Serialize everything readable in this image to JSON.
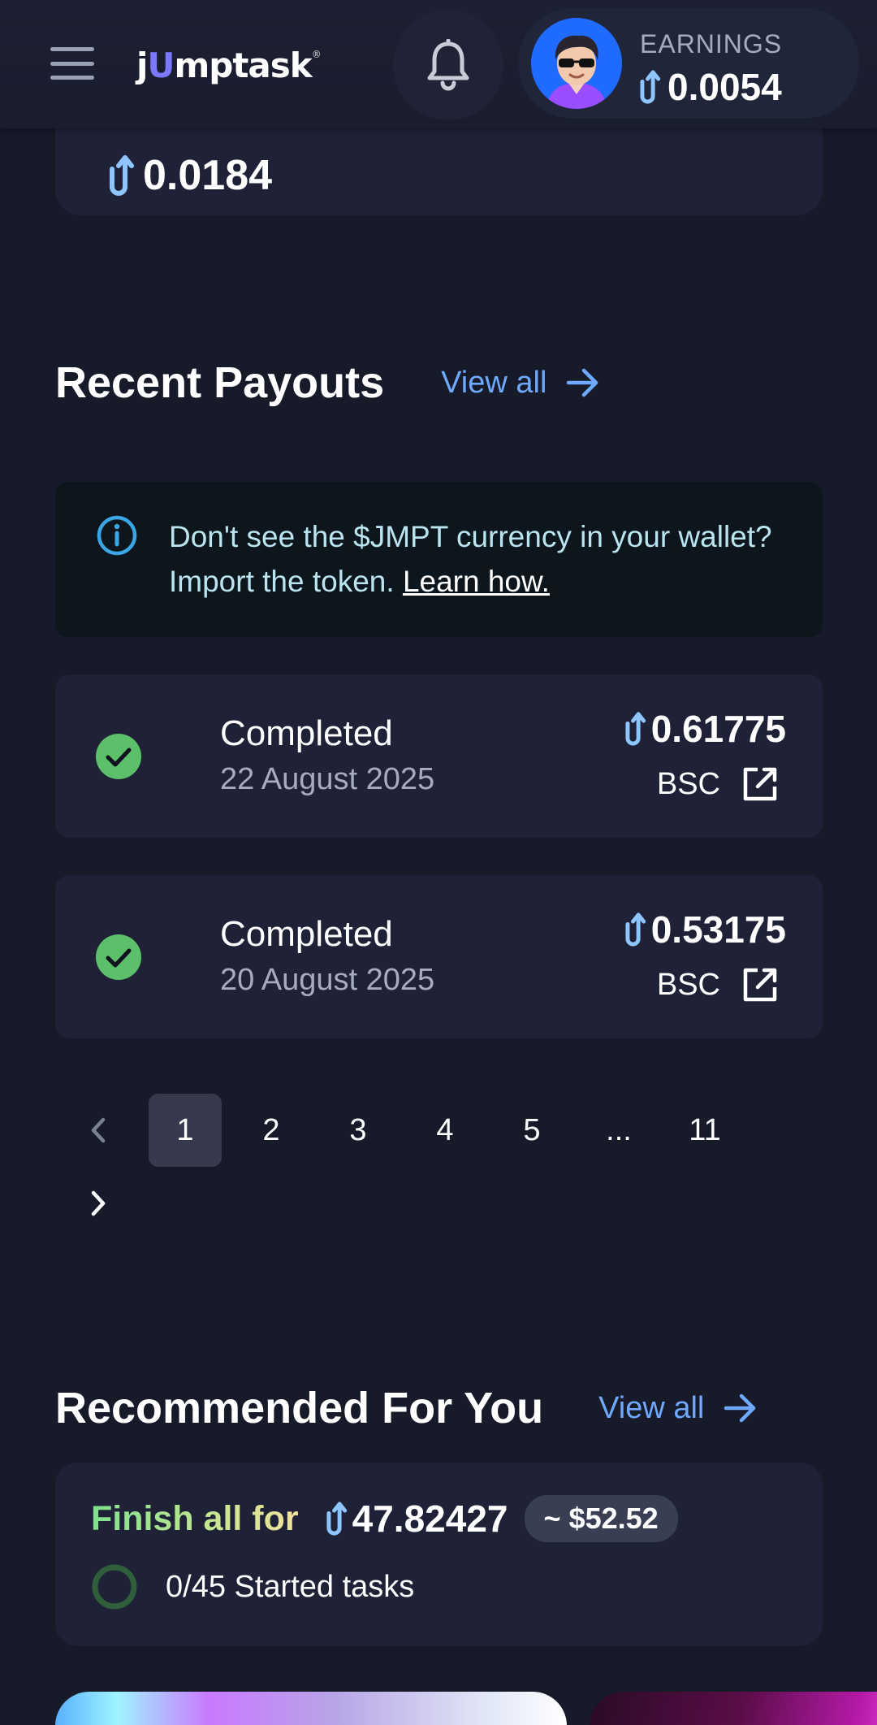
{
  "header": {
    "logo_text": "jumptask",
    "earnings_label": "EARNINGS",
    "earnings_value": "0.0054"
  },
  "top_card": {
    "amount": "0.0184"
  },
  "recent_payouts": {
    "title": "Recent Payouts",
    "view_all": "View all",
    "info": {
      "text": "Don't see the $JMPT currency in your wallet? Import the token.",
      "link": "Learn how."
    },
    "items": [
      {
        "status": "Completed",
        "date": "22 August 2025",
        "amount": "0.61775",
        "chain": "BSC"
      },
      {
        "status": "Completed",
        "date": "20 August 2025",
        "amount": "0.53175",
        "chain": "BSC"
      }
    ]
  },
  "pagination": {
    "pages": [
      "1",
      "2",
      "3",
      "4",
      "5",
      "...",
      "11"
    ],
    "current": "1"
  },
  "recommended": {
    "title": "Recommended For You",
    "view_all": "View all",
    "finish_label": "Finish all for",
    "finish_amount": "47.82427",
    "usd_value": "~ $52.52",
    "progress_text": "0/45 Started tasks"
  },
  "colors": {
    "background": "#171a29",
    "card": "#1f2237",
    "accent_link": "#6ea8ff",
    "success": "#5cbf6a",
    "token": "#8ec5ff"
  },
  "icons": [
    "menu-icon",
    "bell-icon",
    "jmpt-token-icon",
    "arrow-right-icon",
    "info-icon",
    "check-circle-icon",
    "external-link-icon",
    "chevron-left-icon",
    "chevron-right-icon",
    "progress-ring-icon"
  ]
}
